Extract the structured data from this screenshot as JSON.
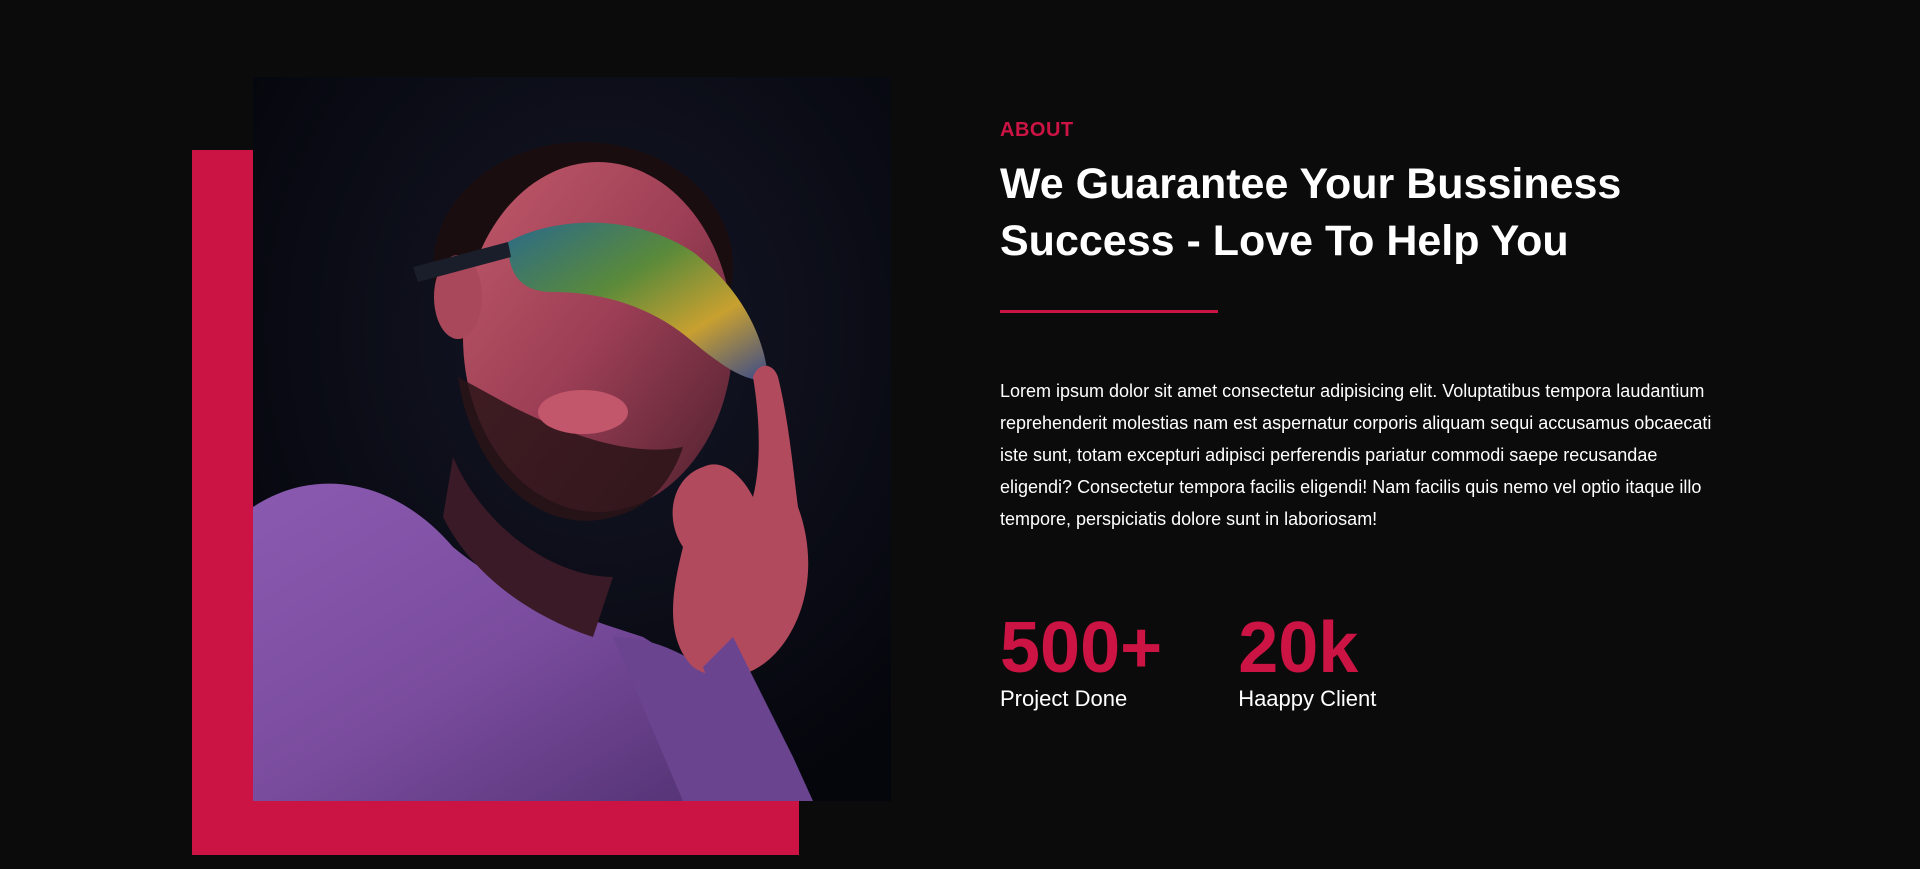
{
  "theme": {
    "background": "#0b0b0c",
    "accent": "#cc1444",
    "text": "#ffffff"
  },
  "about": {
    "eyebrow": "ABOUT",
    "headline": "We Guarantee Your Bussiness Success - Love To Help You",
    "description": "Lorem ipsum dolor sit amet consectetur adipisicing elit. Voluptatibus tempora laudantium reprehenderit molestias nam est aspernatur corporis aliquam sequi accusamus obcaecati iste sunt, totam excepturi adipisci perferendis pariatur commodi saepe recusandae eligendi? Consectetur tempora facilis eligendi! Nam facilis quis nemo vel optio itaque illo tempore, perspiciatis dolore sunt in laboriosam!"
  },
  "stats": [
    {
      "value": "500+",
      "label": "Project Done"
    },
    {
      "value": "20k",
      "label": "Haappy Client"
    }
  ]
}
